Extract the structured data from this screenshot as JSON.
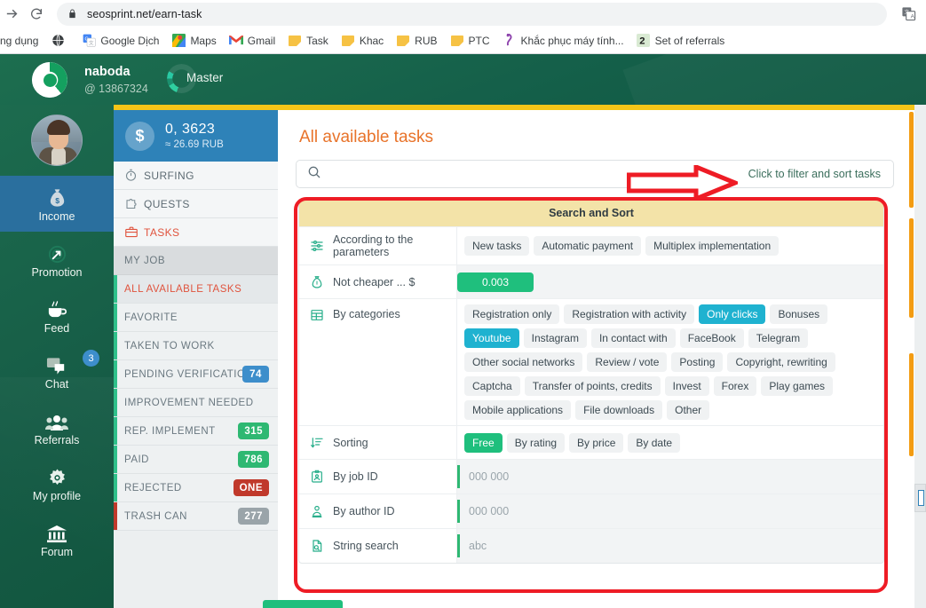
{
  "browser": {
    "url": "seosprint.net/earn-task",
    "back_icon": "back-arrow-icon",
    "reload_icon": "reload-icon",
    "lock_icon": "lock-icon",
    "extension_icon": "translate-extension-icon",
    "bookmarks": [
      {
        "label": "ng dụng",
        "icon": "apps-icon"
      },
      {
        "label": "",
        "icon": "globe-icon"
      },
      {
        "label": "Google Dịch",
        "icon": "google-translate-icon"
      },
      {
        "label": "Maps",
        "icon": "google-maps-icon"
      },
      {
        "label": "Gmail",
        "icon": "gmail-icon"
      },
      {
        "label": "Task",
        "icon": "folder-icon"
      },
      {
        "label": "Khac",
        "icon": "folder-icon"
      },
      {
        "label": "RUB",
        "icon": "folder-icon"
      },
      {
        "label": "PTC",
        "icon": "folder-icon"
      },
      {
        "label": "Khắc phục máy tính...",
        "icon": "bookmark-icon"
      },
      {
        "label": "Set of referrals",
        "icon": "number-two-icon"
      }
    ]
  },
  "header": {
    "logo_icon": "seosprint-logo-icon",
    "username": "naboda",
    "user_id": "@ 13867324",
    "rank_label": "Master",
    "rank_icon": "rank-ring-icon"
  },
  "rail": {
    "avatar_name": "user-avatar",
    "items": [
      {
        "label": "Income",
        "icon": "money-bag-icon",
        "active": true,
        "badge": ""
      },
      {
        "label": "Promotion",
        "icon": "target-arrow-icon",
        "active": false,
        "badge": ""
      },
      {
        "label": "Feed",
        "icon": "coffee-cup-icon",
        "active": false,
        "badge": ""
      },
      {
        "label": "Chat",
        "icon": "chat-bubble-icon",
        "active": false,
        "badge": "3"
      },
      {
        "label": "Referrals",
        "icon": "people-group-icon",
        "active": false,
        "badge": ""
      },
      {
        "label": "My profile",
        "icon": "gear-icon",
        "active": false,
        "badge": ""
      },
      {
        "label": "Forum",
        "icon": "bank-columns-icon",
        "active": false,
        "badge": ""
      }
    ]
  },
  "sidebar": {
    "balance": {
      "currency_symbol": "$",
      "amount": "0, 3623",
      "converted": "≈ 26.69 RUB"
    },
    "nav": [
      {
        "label": "SURFING",
        "icon": "stopwatch-icon",
        "active": false
      },
      {
        "label": "QUESTS",
        "icon": "puzzle-icon",
        "active": false
      },
      {
        "label": "TASKS",
        "icon": "briefcase-icon",
        "active": true
      }
    ],
    "section_title": "MY JOB",
    "jobs": [
      {
        "label": "ALL AVAILABLE TASKS",
        "badge": "",
        "badge_color": "",
        "active": true
      },
      {
        "label": "FAVORITE",
        "badge": "",
        "badge_color": "",
        "active": false
      },
      {
        "label": "TAKEN TO WORK",
        "badge": "",
        "badge_color": "",
        "active": false
      },
      {
        "label": "PENDING VERIFICATION",
        "badge": "74",
        "badge_color": "#3d8ecb",
        "active": false
      },
      {
        "label": "IMPROVEMENT NEEDED",
        "badge": "",
        "badge_color": "",
        "active": false
      },
      {
        "label": "REP. IMPLEMENT",
        "badge": "315",
        "badge_color": "#2eb872",
        "active": false
      },
      {
        "label": "PAID",
        "badge": "786",
        "badge_color": "#2eb872",
        "active": false
      },
      {
        "label": "REJECTED",
        "badge": "ONE",
        "badge_color": "#c0392b",
        "active": false
      },
      {
        "label": "TRASH CAN",
        "badge": "277",
        "badge_color": "#9aa4a9",
        "active": false
      }
    ]
  },
  "main": {
    "page_title": "All available tasks",
    "search": {
      "icon": "search-icon",
      "placeholder": "",
      "value": ""
    },
    "filter_hint": "Click to filter and sort tasks",
    "panel_title": "Search and Sort",
    "rows": [
      {
        "label": "According to the parameters",
        "icon": "sliders-icon",
        "type": "chips",
        "chips": [
          {
            "label": "New tasks",
            "active": false
          },
          {
            "label": "Automatic payment",
            "active": false
          },
          {
            "label": "Multiplex implementation",
            "active": false
          }
        ]
      },
      {
        "label": "Not cheaper ... $",
        "icon": "money-bag-icon",
        "type": "money",
        "value": "0.003"
      },
      {
        "label": "By categories",
        "icon": "grid-table-icon",
        "type": "chips",
        "chips": [
          {
            "label": "Registration only",
            "active": false
          },
          {
            "label": "Registration with activity",
            "active": false
          },
          {
            "label": "Only clicks",
            "active": true
          },
          {
            "label": "Bonuses",
            "active": false
          },
          {
            "label": "Youtube",
            "active": true
          },
          {
            "label": "Instagram",
            "active": false
          },
          {
            "label": "In contact with",
            "active": false
          },
          {
            "label": "FaceBook",
            "active": false
          },
          {
            "label": "Telegram",
            "active": false
          },
          {
            "label": "Other social networks",
            "active": false
          },
          {
            "label": "Review / vote",
            "active": false
          },
          {
            "label": "Posting",
            "active": false
          },
          {
            "label": "Copyright, rewriting",
            "active": false
          },
          {
            "label": "Captcha",
            "active": false
          },
          {
            "label": "Transfer of points, credits",
            "active": false
          },
          {
            "label": "Invest",
            "active": false
          },
          {
            "label": "Forex",
            "active": false
          },
          {
            "label": "Play games",
            "active": false
          },
          {
            "label": "Mobile applications",
            "active": false
          },
          {
            "label": "File downloads",
            "active": false
          },
          {
            "label": "Other",
            "active": false
          }
        ]
      },
      {
        "label": "Sorting",
        "icon": "sort-descending-icon",
        "type": "chips",
        "chips": [
          {
            "label": "Free",
            "active": true,
            "green": true
          },
          {
            "label": "By rating",
            "active": false
          },
          {
            "label": "By price",
            "active": false
          },
          {
            "label": "By date",
            "active": false
          }
        ]
      },
      {
        "label": "By job ID",
        "icon": "id-card-icon",
        "type": "input",
        "placeholder": "000 000",
        "value": ""
      },
      {
        "label": "By author ID",
        "icon": "author-icon",
        "type": "input",
        "placeholder": "000 000",
        "value": ""
      },
      {
        "label": "String search",
        "icon": "document-search-icon",
        "type": "input",
        "placeholder": "abc",
        "value": ""
      }
    ]
  },
  "annotations": {
    "arrow": "red-arrow-pointing-to-filter-hint",
    "box": "red-rounded-rectangle-around-search-and-sort-panel"
  },
  "colors": {
    "brand_green": "#15604a",
    "accent_orange": "#f39c12",
    "title_orange": "#e8732a",
    "panel_header_yellow": "#f3e3a8",
    "chip_active_cyan": "#1fb2d0",
    "chip_active_green": "#1fbf7d",
    "balance_blue": "#2e82b8",
    "annotation_red": "#ee1c25",
    "active_red_text": "#e0533d"
  }
}
